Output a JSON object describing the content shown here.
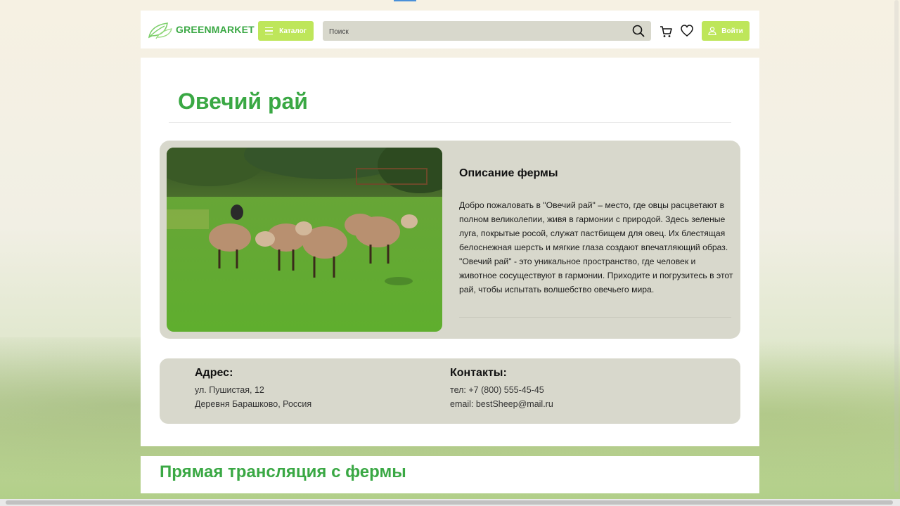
{
  "header": {
    "logo_text": "GREENMARKET",
    "catalog_label": "Каталог",
    "search_placeholder": "Поиск",
    "login_label": "Войти"
  },
  "farm": {
    "title": "Овечий рай",
    "description_title": "Описание фермы",
    "description_text": "Добро пожаловать в \"Овечий рай\" – место, где овцы расцветают в полном великолепии, живя в гармонии с природой. Здесь зеленые луга, покрытые росой, служат пастбищем для овец. Их блестящая белоснежная шерсть и мягкие глаза создают впечатляющий образ. \"Овечий рай\" - это уникальное пространство, где человек и животное сосуществуют в гармонии. Приходите и погрузитесь в этот рай, чтобы испытать волшебство овечьего мира."
  },
  "address": {
    "heading": "Адрес:",
    "line1": "ул. Пушистая, 12",
    "line2": "Деревня Барашково, Россия"
  },
  "contacts": {
    "heading": "Контакты:",
    "phone": "тел: +7 (800) 555-45-45",
    "email": "email: bestSheep@mail.ru"
  },
  "stream": {
    "title": "Прямая трансляция с фермы"
  },
  "colors": {
    "brand_green": "#3aa844",
    "accent_lime": "#bee65a",
    "panel_bg": "#d8d8cc"
  }
}
